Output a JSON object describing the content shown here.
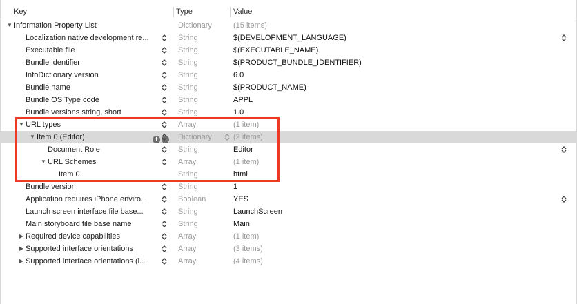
{
  "header": {
    "key": "Key",
    "type": "Type",
    "value": "Value"
  },
  "rows": [
    {
      "key": "Information Property List",
      "type": "Dictionary",
      "value": "(15 items)"
    },
    {
      "key": "Localization native development re...",
      "type": "String",
      "value": "$(DEVELOPMENT_LANGUAGE)"
    },
    {
      "key": "Executable file",
      "type": "String",
      "value": "$(EXECUTABLE_NAME)"
    },
    {
      "key": "Bundle identifier",
      "type": "String",
      "value": "$(PRODUCT_BUNDLE_IDENTIFIER)"
    },
    {
      "key": "InfoDictionary version",
      "type": "String",
      "value": "6.0"
    },
    {
      "key": "Bundle name",
      "type": "String",
      "value": "$(PRODUCT_NAME)"
    },
    {
      "key": "Bundle OS Type code",
      "type": "String",
      "value": "APPL"
    },
    {
      "key": "Bundle versions string, short",
      "type": "String",
      "value": "1.0"
    },
    {
      "key": "URL types",
      "type": "Array",
      "value": "(1 item)"
    },
    {
      "key": "Item 0 (Editor)",
      "type": "Dictionary",
      "value": "(2 items)"
    },
    {
      "key": "Document Role",
      "type": "String",
      "value": "Editor"
    },
    {
      "key": "URL Schemes",
      "type": "Array",
      "value": "(1 item)"
    },
    {
      "key": "Item 0",
      "type": "String",
      "value": "html"
    },
    {
      "key": "Bundle version",
      "type": "String",
      "value": "1"
    },
    {
      "key": "Application requires iPhone enviro...",
      "type": "Boolean",
      "value": "YES"
    },
    {
      "key": "Launch screen interface file base...",
      "type": "String",
      "value": "LaunchScreen"
    },
    {
      "key": "Main storyboard file base name",
      "type": "String",
      "value": "Main"
    },
    {
      "key": "Required device capabilities",
      "type": "Array",
      "value": "(1 item)"
    },
    {
      "key": "Supported interface orientations",
      "type": "Array",
      "value": "(3 items)"
    },
    {
      "key": "Supported interface orientations (i...",
      "type": "Array",
      "value": "(4 items)"
    }
  ],
  "colors": {
    "highlight": "#ee3a24",
    "selected_row": "#d9d9d9"
  }
}
